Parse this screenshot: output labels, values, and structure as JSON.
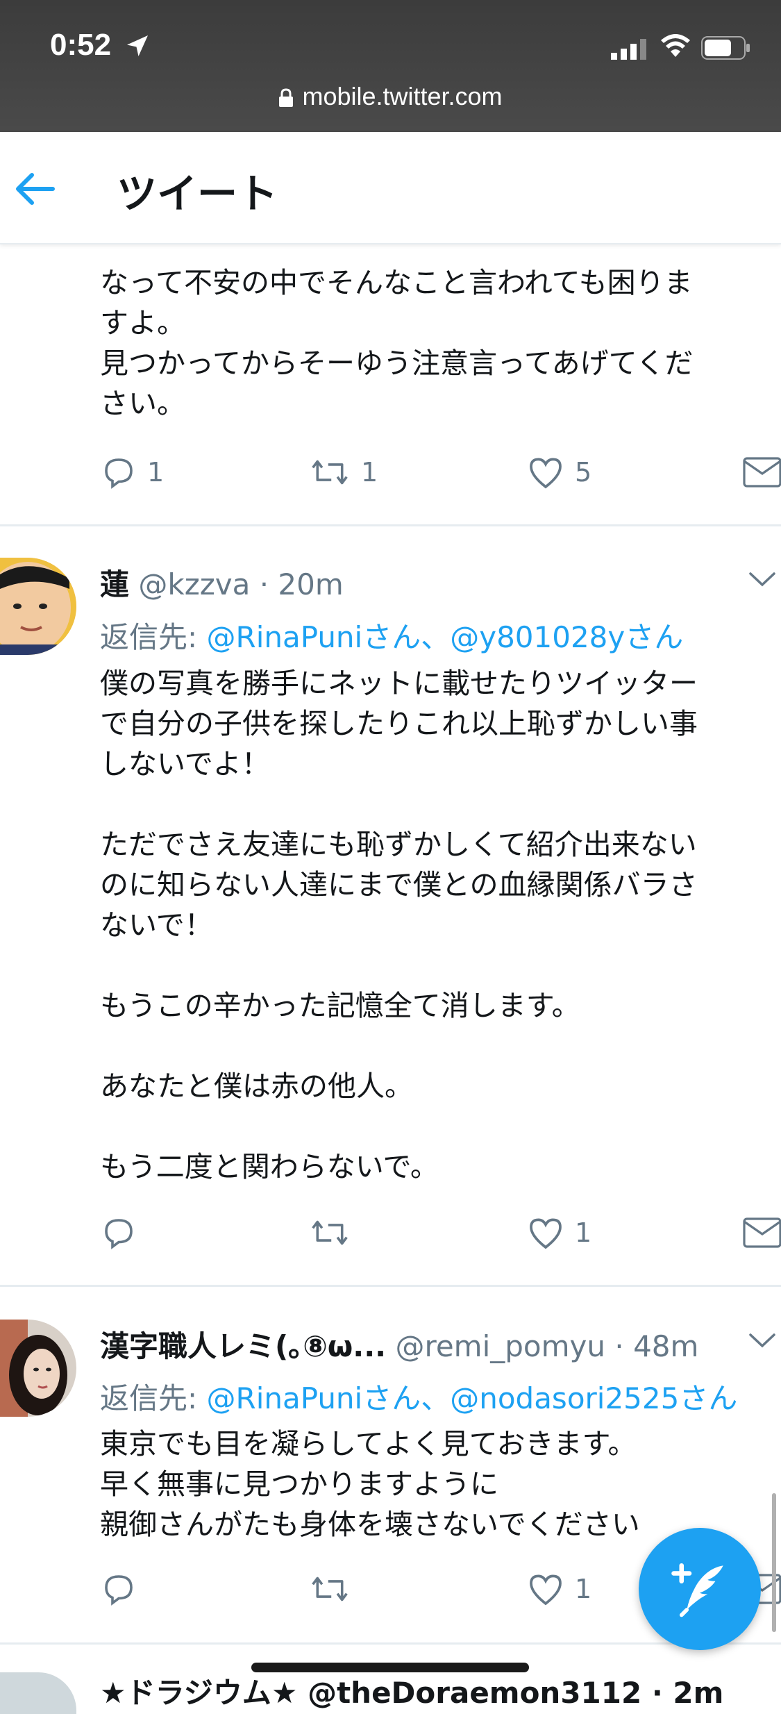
{
  "status": {
    "time": "0:52"
  },
  "url": "mobile.twitter.com",
  "header": {
    "title": "ツイート"
  },
  "tweets": [
    {
      "text": "確かにそうかもしれませんが、今子供が居なく\nなって不安の中でそんなこと言われても困りま\nすよ。\n見つかってからそーゆう注意言ってあげてくだ\nさい。",
      "reply_count": "1",
      "retweet_count": "1",
      "like_count": "5"
    },
    {
      "name": "蓮",
      "handle": "@kzzva · 20m",
      "reply_prefix": "返信先: ",
      "reply_mentions": "@RinaPuniさん、@y801028yさん",
      "text": "僕の写真を勝手にネットに載せたりツイッター\nで自分の子供を探したりこれ以上恥ずかしい事\nしないでよ！\n\nただでさえ友達にも恥ずかしくて紹介出来ない\nのに知らない人達にまで僕との血縁関係バラさ\nないで！\n\nもうこの辛かった記憶全て消します。\n\nあなたと僕は赤の他人。\n\nもう二度と関わらないで。",
      "like_count": "1"
    },
    {
      "name": "漢字職人レミ(｡⑧ω...",
      "handle": "@remi_pomyu · 48m",
      "reply_prefix": "返信先: ",
      "reply_mentions": "@RinaPuniさん、@nodasori2525さん",
      "text": "東京でも目を凝らしてよく見ておきます。\n早く無事に見つかりますように\n親御さんがたも身体を壊さないでください",
      "like_count": "1"
    }
  ],
  "next_tweet_name_partial": "★ドラジウム★ @theDoraemon3112 · 2m",
  "colors": {
    "accent": "#1da1f2",
    "secondary_text": "#657786",
    "status_bar": "#424242"
  }
}
